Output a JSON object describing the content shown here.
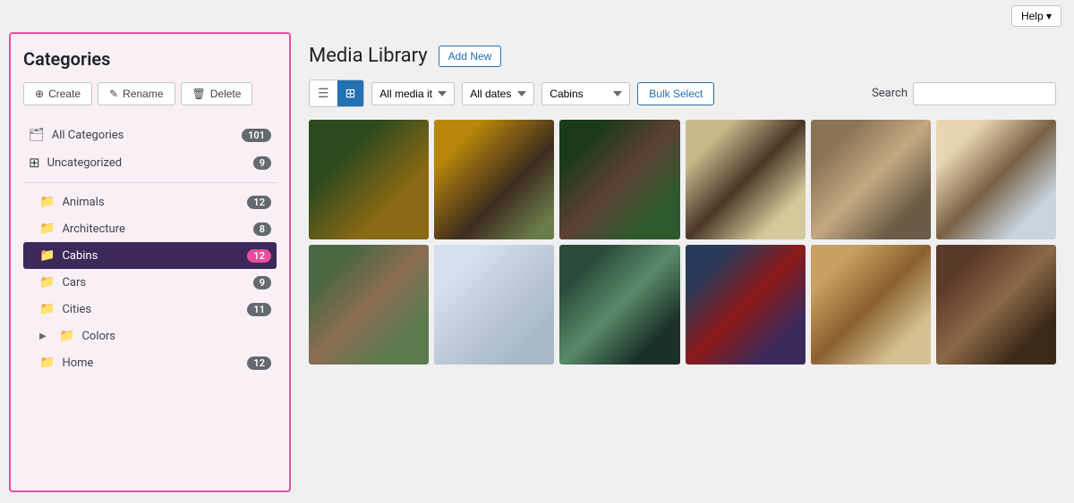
{
  "topbar": {
    "help_label": "Help ▾"
  },
  "sidebar": {
    "title": "Categories",
    "actions": {
      "create": "⊕ Create",
      "rename": "✎ Rename",
      "delete": "🗑 Delete"
    },
    "categories": [
      {
        "id": "all",
        "label": "All Categories",
        "count": 101,
        "indent": false,
        "icon": "🗂",
        "active": false
      },
      {
        "id": "uncategorized",
        "label": "Uncategorized",
        "count": 9,
        "indent": false,
        "icon": "⊞",
        "active": false
      },
      {
        "id": "animals",
        "label": "Animals",
        "count": 12,
        "indent": true,
        "icon": "📁",
        "active": false
      },
      {
        "id": "architecture",
        "label": "Architecture",
        "count": 8,
        "indent": true,
        "icon": "📁",
        "active": false
      },
      {
        "id": "cabins",
        "label": "Cabins",
        "count": 12,
        "indent": true,
        "icon": "📁",
        "active": true
      },
      {
        "id": "cars",
        "label": "Cars",
        "count": 9,
        "indent": true,
        "icon": "📁",
        "active": false
      },
      {
        "id": "cities",
        "label": "Cities",
        "count": 11,
        "indent": true,
        "icon": "📁",
        "active": false
      },
      {
        "id": "colors",
        "label": "Colors",
        "count": null,
        "indent": true,
        "icon": "📁",
        "active": false,
        "expandable": true
      },
      {
        "id": "home",
        "label": "Home",
        "count": 12,
        "indent": true,
        "icon": "📁",
        "active": false
      }
    ]
  },
  "media_library": {
    "title": "Media Library",
    "add_new": "Add New",
    "toolbar": {
      "filter_media": "All media it",
      "filter_dates": "All dates",
      "filter_category": "Cabins",
      "bulk_select": "Bulk Select",
      "search_label": "Search"
    },
    "images": [
      {
        "id": 1,
        "class": "cabin-1",
        "alt": "Cabin in trees"
      },
      {
        "id": 2,
        "class": "cabin-2",
        "alt": "Modern cabin on stilts"
      },
      {
        "id": 3,
        "class": "cabin-3",
        "alt": "Dark cabin in forest"
      },
      {
        "id": 4,
        "class": "cabin-4",
        "alt": "Cabin in field mountains"
      },
      {
        "id": 5,
        "class": "cabin-5",
        "alt": "Rustic cabin with couple"
      },
      {
        "id": 6,
        "class": "cabin-6",
        "alt": "Snowy cabin"
      },
      {
        "id": 7,
        "class": "cabin-7",
        "alt": "Green cabin on stilts"
      },
      {
        "id": 8,
        "class": "cabin-8",
        "alt": "Snowy white landscape cabin"
      },
      {
        "id": 9,
        "class": "cabin-9",
        "alt": "Green forest cabin path"
      },
      {
        "id": 10,
        "class": "cabin-10",
        "alt": "Dark blue cabin"
      },
      {
        "id": 11,
        "class": "cabin-11",
        "alt": "Yellow door cabin autumn"
      },
      {
        "id": 12,
        "class": "cabin-12",
        "alt": "Dark wooden cabin"
      }
    ]
  }
}
